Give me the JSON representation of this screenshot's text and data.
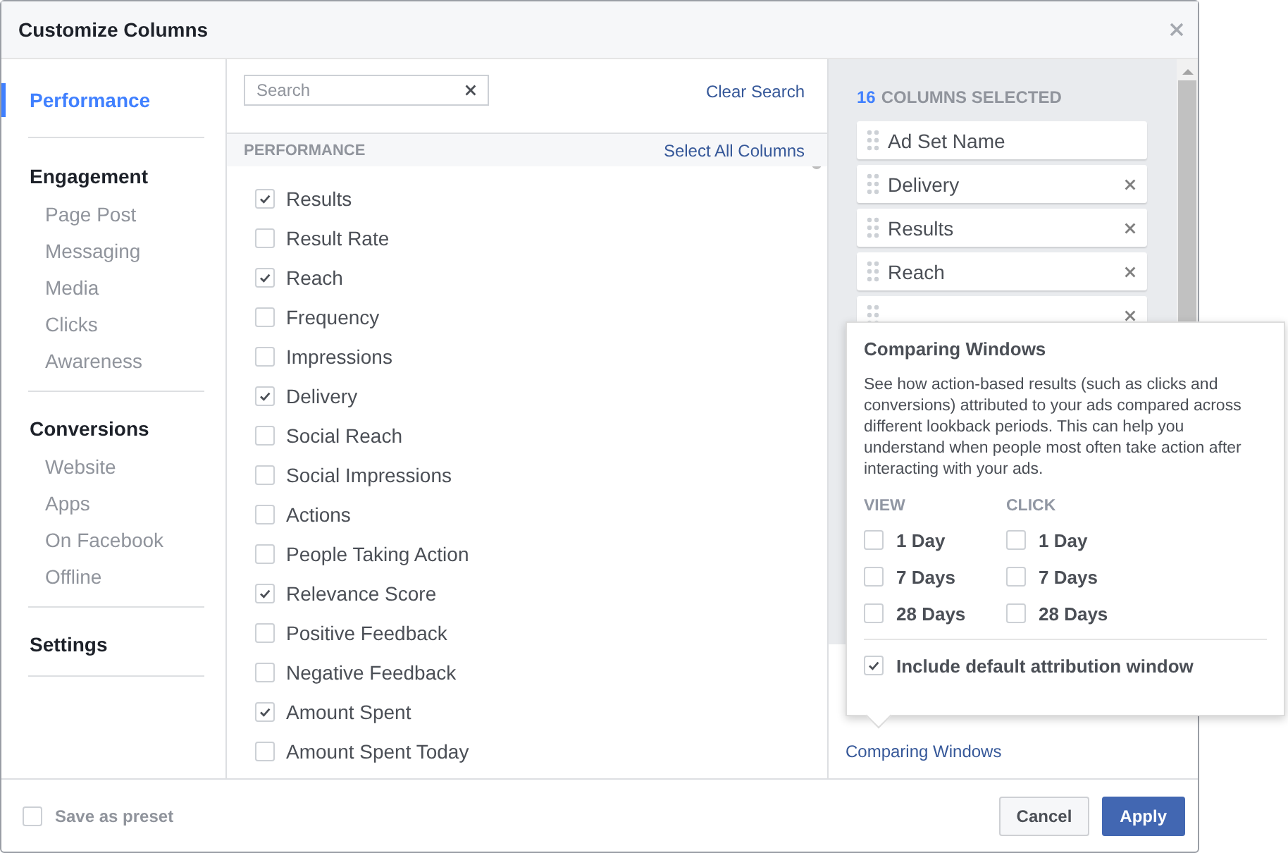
{
  "dialog": {
    "title": "Customize Columns"
  },
  "sidebar": {
    "items": [
      {
        "label": "Performance",
        "selected": true
      },
      {
        "label": "Engagement",
        "selected": false,
        "children": [
          {
            "label": "Page Post",
            "selected": false
          },
          {
            "label": "Messaging",
            "selected": false
          },
          {
            "label": "Media",
            "selected": false
          },
          {
            "label": "Clicks",
            "selected": false
          },
          {
            "label": "Awareness",
            "selected": false
          }
        ]
      },
      {
        "label": "Conversions",
        "selected": false,
        "children": [
          {
            "label": "Website",
            "selected": false
          },
          {
            "label": "Apps",
            "selected": false
          },
          {
            "label": "On Facebook",
            "selected": false
          },
          {
            "label": "Offline",
            "selected": false
          }
        ]
      },
      {
        "label": "Settings",
        "selected": false
      }
    ]
  },
  "search": {
    "placeholder": "Search",
    "clear_link": "Clear Search"
  },
  "section": {
    "title": "PERFORMANCE",
    "select_all": "Select All Columns",
    "items": [
      {
        "label": "Results",
        "checked": true
      },
      {
        "label": "Result Rate",
        "checked": false
      },
      {
        "label": "Reach",
        "checked": true
      },
      {
        "label": "Frequency",
        "checked": false
      },
      {
        "label": "Impressions",
        "checked": false
      },
      {
        "label": "Delivery",
        "checked": true
      },
      {
        "label": "Social Reach",
        "checked": false
      },
      {
        "label": "Social Impressions",
        "checked": false
      },
      {
        "label": "Actions",
        "checked": false
      },
      {
        "label": "People Taking Action",
        "checked": false
      },
      {
        "label": "Relevance Score",
        "checked": true
      },
      {
        "label": "Positive Feedback",
        "checked": false
      },
      {
        "label": "Negative Feedback",
        "checked": false
      },
      {
        "label": "Amount Spent",
        "checked": true
      },
      {
        "label": "Amount Spent Today",
        "checked": false
      }
    ]
  },
  "selected_columns": {
    "count": "16",
    "label": "COLUMNS SELECTED",
    "items": [
      {
        "label": "Ad Set Name",
        "removable": false
      },
      {
        "label": "Delivery",
        "removable": true
      },
      {
        "label": "Results",
        "removable": true
      },
      {
        "label": "Reach",
        "removable": true
      },
      {
        "removable": true
      }
    ],
    "link": "Comparing Windows"
  },
  "popover": {
    "title": "Comparing Windows",
    "description": "See how action-based results (such as clicks and conversions) attributed to your ads compared across different lookback periods. This can help you understand when people most often take action after interacting with your ads.",
    "groups": [
      {
        "title": "VIEW",
        "options": [
          {
            "label": "1 Day",
            "checked": false
          },
          {
            "label": "7 Days",
            "checked": false
          },
          {
            "label": "28 Days",
            "checked": false
          }
        ]
      },
      {
        "title": "CLICK",
        "options": [
          {
            "label": "1 Day",
            "checked": false
          },
          {
            "label": "7 Days",
            "checked": false
          },
          {
            "label": "28 Days",
            "checked": false
          }
        ]
      }
    ],
    "default_option": {
      "label": "Include default attribution window",
      "checked": true
    }
  },
  "footer": {
    "preset": {
      "label": "Save as preset",
      "checked": false
    },
    "buttons": [
      {
        "label": "Cancel",
        "kind": "secondary"
      },
      {
        "label": "Apply",
        "kind": "primary"
      }
    ]
  }
}
